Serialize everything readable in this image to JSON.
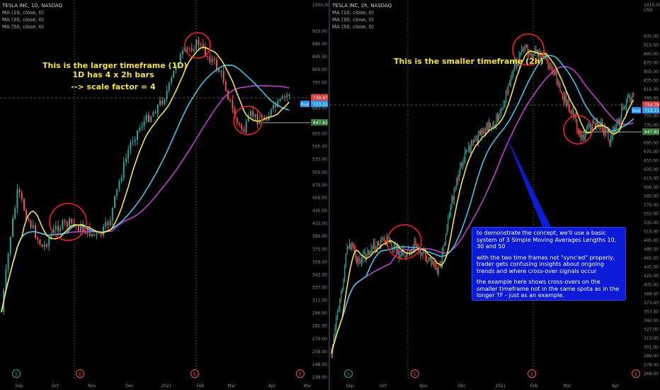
{
  "left": {
    "title": "TESLA INC, 1D, NASDAQ",
    "ma_labels": [
      "MA (10, close, 0)",
      "MA (30, close, 0)",
      "MA (50, close, 0)"
    ],
    "annotation_line1": "This is the larger timeframe (1D)",
    "annotation_line2": "1D has 4 x 2h bars",
    "annotation_line3": "--> scale factor = 4",
    "price_ticks": [
      "925.00",
      "885.00",
      "845.00",
      "805.00",
      "765.00",
      "725.00",
      "685.00",
      "645.00",
      "605.00",
      "565.00",
      "535.00",
      "505.00",
      "475.00",
      "455.00",
      "435.00",
      "415.00",
      "395.00",
      "375.00",
      "359.00",
      "343.00",
      "327.00",
      "311.00",
      "296.00",
      "282.00",
      "270.00",
      "258.00",
      "248.00",
      "238.00"
    ],
    "top_tick": "1000.00",
    "badges": {
      "price_top": "739.67",
      "price_2": "713.11",
      "post_label": "Post",
      "level": "647.81"
    },
    "time_ticks": [
      "Sep",
      "Oct",
      "Nov",
      "Dec",
      "2021",
      "Feb",
      "Mar",
      "Apr",
      "Mar"
    ],
    "event_markers": [
      "S",
      "E",
      "E",
      "E"
    ]
  },
  "right": {
    "title": "TESLA INC, 2h, NASDAQ",
    "ma_labels": [
      "MA (10, close, 0)",
      "MA (30, close, 0)",
      "MA (50, close, 0)"
    ],
    "annotation": "This is the smaller timeframe (2h)",
    "callout": {
      "p1": "to demonstrate the concept, we'll use a basic system of 3 Simple Moving Averages Lengths 10, 30 and 50",
      "p2": "with the two time frames not \"sync'ed\" properly, trader gets confusing insights about ongoing trends and where cross-over signals occur",
      "p3": "the example here shows cross-overs on the smaller timeframe not in the same spota as in the longer TF - just as an example."
    },
    "price_ticks": [
      "935.00",
      "915.00",
      "895.00",
      "875.00",
      "855.00",
      "835.00",
      "815.00",
      "795.00",
      "775.00",
      "755.00",
      "735.00",
      "715.00",
      "695.00",
      "675.00",
      "655.00",
      "635.00",
      "615.00",
      "600.00",
      "585.00",
      "570.00",
      "555.00",
      "535.00",
      "515.00",
      "495.00",
      "480.00",
      "465.00",
      "445.00",
      "425.00",
      "405.00",
      "389.00",
      "373.00",
      "357.00",
      "342.00",
      "327.00",
      "313.00",
      "301.00",
      "289.00",
      "278.00",
      "268.00"
    ],
    "top_tick": "1015.00",
    "unit": "USD",
    "badges": {
      "price_top": "754.79",
      "price_2": "713.11",
      "post_label": "Post",
      "level": "647.81"
    },
    "time_ticks": [
      "Sep",
      "Oct",
      "Nov",
      "Dec",
      "2021",
      "Feb",
      "Mar",
      "Apr"
    ],
    "event_markers": [
      "S",
      "E",
      "E",
      "E"
    ]
  },
  "colors": {
    "ma10": "#f4e542",
    "ma30": "#3ec6e6",
    "ma50": "#c13fd0",
    "up": "#26a69a",
    "down": "#ef5350",
    "circle": "#ff1f1f",
    "dotted": "#2e9e3a"
  }
}
